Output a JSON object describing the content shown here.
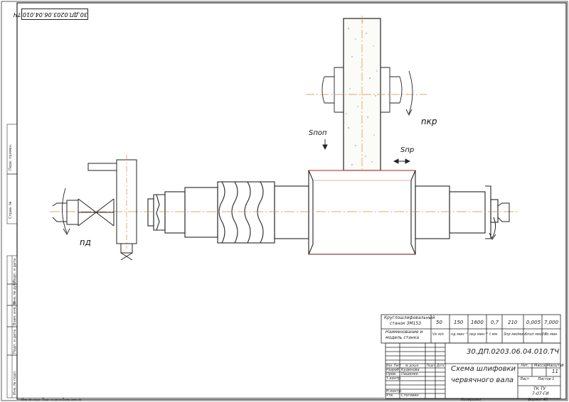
{
  "stamp_code": "30.ДП.0203.06.04.010.ТЧ",
  "labels": {
    "n_kr": "nкр",
    "n_d": "nд",
    "s_pop": "Sпоп",
    "s_pr": "Sпр"
  },
  "param_table": {
    "row1_title_line1": "Круглошлифовальный",
    "row1_title_line2": "станок ЗМ153",
    "row2_title_line1": "Наименование и",
    "row2_title_line2": "модель станка",
    "values": [
      "50",
      "150",
      "1600",
      "0,7",
      "210",
      "0,005",
      "7,000"
    ],
    "headers": [
      "Vк м/с",
      "nд мин⁻¹",
      "nкр мин⁻¹",
      "t мм",
      "Sпр мм/мин",
      "Sпоп мм/2х",
      "To мин"
    ]
  },
  "title_block": {
    "doc_code": "30.ДП.0203.06.04.010.ТЧ",
    "title_line1": "Схема шлифовки",
    "title_line2": "червячного вала",
    "sheet_label": "Лит.",
    "mass_label": "Масса",
    "scale_label": "Масштаб",
    "sheet_count": "11",
    "sheet_word": "Лист",
    "sheets_word": "Листов 1",
    "group_line1": "ТК ТУ",
    "group_line2": "7-07-ГИ",
    "roles": [
      "Изм. Лист",
      "№ докум.",
      "Подп.",
      "Дата"
    ],
    "dev_role": "Разраб.",
    "dev_name": "Кудинова",
    "check_role": "Пров.",
    "check_name": "Пашенко",
    "tcontrol_role": "Т.контр.",
    "ncontrol_role": "Н.контр.",
    "approve_role": "Утв.",
    "approve_name": "Стоговин"
  },
  "bottom_strip": {
    "copied": "Копировал",
    "format": "Формат А3",
    "left_note": "Инв. № подл.    Подп. и дата    Взам. инв. №"
  },
  "side_strip": [
    "Перв. примен.",
    "Справ. №",
    "Подп. и дата",
    "Инв. № дубл.",
    "Взам. инв. №",
    "Подп. и дата",
    "Инв. № подл."
  ]
}
